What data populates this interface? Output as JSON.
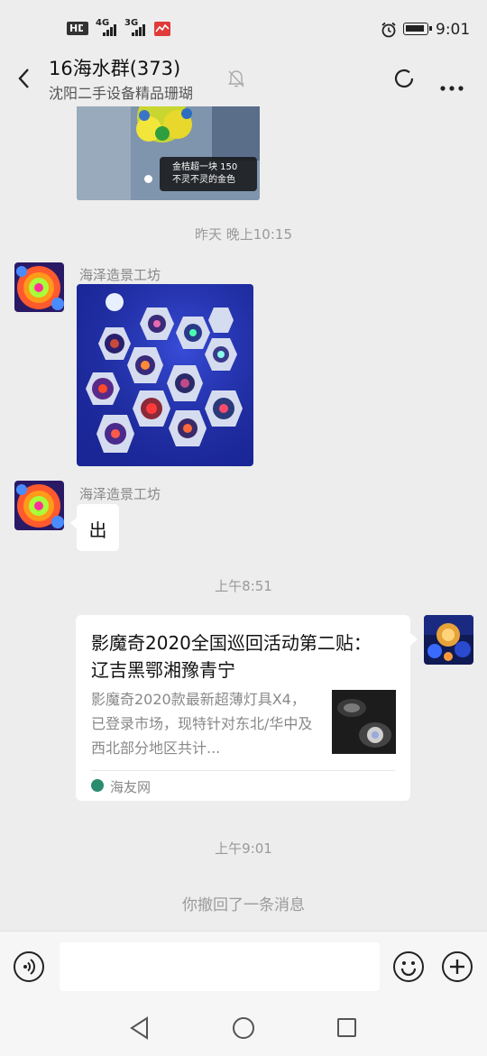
{
  "status_bar": {
    "hd_badge": "HD",
    "net1": "4G",
    "net2": "3G",
    "time": "9:01"
  },
  "header": {
    "title": "16海水群(373)",
    "subtitle": "沈阳二手设备精品珊瑚"
  },
  "messages": {
    "top_image_caption_line1": "金桔超一块 150",
    "top_image_caption_line2": "不灵不灵的金色",
    "time1": "昨天 晚上10:15",
    "msg1_sender": "海泽造景工坊",
    "msg2_sender": "海泽造景工坊",
    "msg2_text": "出",
    "time2": "上午8:51",
    "card_title": "影魔奇2020全国巡回活动第二贴： 辽吉黑鄂湘豫青宁",
    "card_desc": "影魔奇2020款最新超薄灯具X4，已登录市场，现特针对东北/华中及西北部分地区共计...",
    "card_source": "海友网",
    "time3": "上午9:01",
    "recall_notice": "你撤回了一条消息"
  },
  "colors": {
    "background": "#ededed",
    "bubble": "#ffffff",
    "timestamp": "#9a9a9a"
  }
}
